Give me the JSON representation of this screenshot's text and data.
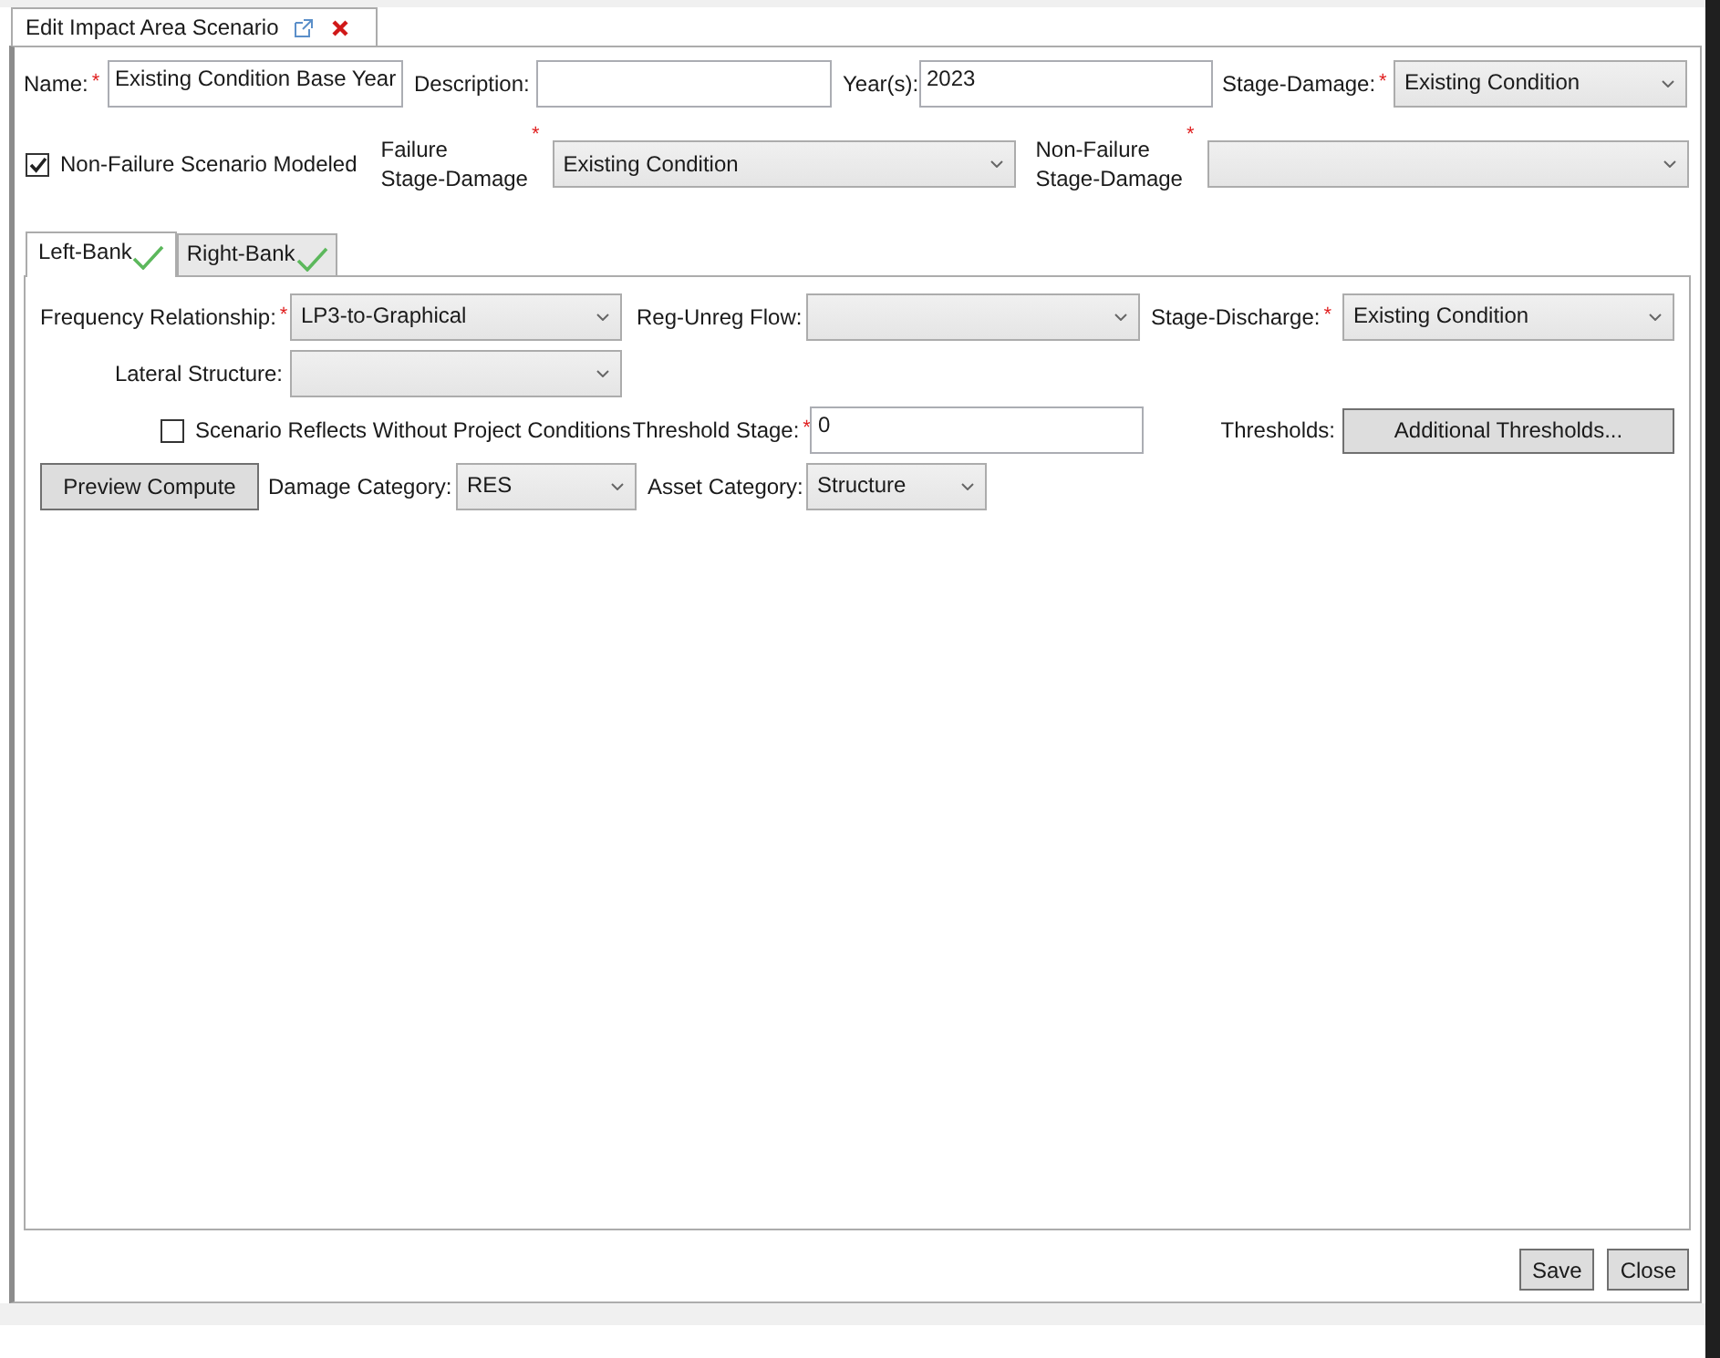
{
  "document_tab": {
    "title": "Edit Impact Area Scenario",
    "selected": true
  },
  "top_row": [
    {
      "kind": "text",
      "label": "Name:",
      "asterisk": "*",
      "value": "Existing Condition Base Year"
    },
    {
      "kind": "text",
      "label": "Description:"
    },
    {
      "kind": "text",
      "label": "Year(s):",
      "value": "2023"
    },
    {
      "kind": "dropdown",
      "label": "Stage-Damage:",
      "asterisk": "*",
      "value": "Existing Condition"
    }
  ],
  "second_row": [
    {
      "kind": "checkbox",
      "label": "Non-Failure Scenario Modeled",
      "checked": true
    },
    {
      "kind": "dropdown",
      "label": "Failure\nStage-Damage",
      "asterisk": "*",
      "value": "Existing Condition"
    },
    {
      "kind": "dropdown",
      "label": "Non-Failure\nStage-Damage",
      "asterisk": "*"
    }
  ],
  "bank_tabs": [
    {
      "label": "Left-Bank",
      "selected": true,
      "valid": true
    },
    {
      "label": "Right-Bank",
      "selected": false,
      "valid": true
    }
  ],
  "panel_rows": [
    [
      {
        "kind": "dropdown",
        "label": "Frequency Relationship:",
        "asterisk": "*",
        "value": "LP3-to-Graphical"
      },
      {
        "kind": "dropdown",
        "label": "Reg-Unreg Flow:"
      },
      {
        "kind": "dropdown",
        "label": "Stage-Discharge:",
        "asterisk": "*",
        "value": "Existing Condition"
      }
    ],
    [
      {
        "kind": "dropdown",
        "label": "Lateral Structure:"
      }
    ],
    [
      {
        "kind": "checkbox",
        "label": "Scenario Reflects Without Project Conditions",
        "checked": false
      },
      {
        "kind": "text",
        "label": "Threshold Stage:",
        "asterisk": "*",
        "value": "0"
      },
      {
        "kind": "button",
        "label": "Thresholds:",
        "text": "Additional Thresholds..."
      }
    ],
    [
      {
        "kind": "button",
        "text": "Preview Compute"
      },
      {
        "kind": "dropdown",
        "label": "Damage Category:",
        "value": "RES"
      },
      {
        "kind": "dropdown",
        "label": "Asset Category:",
        "value": "Structure"
      }
    ]
  ],
  "footer_buttons": [
    "Save",
    "Close"
  ]
}
